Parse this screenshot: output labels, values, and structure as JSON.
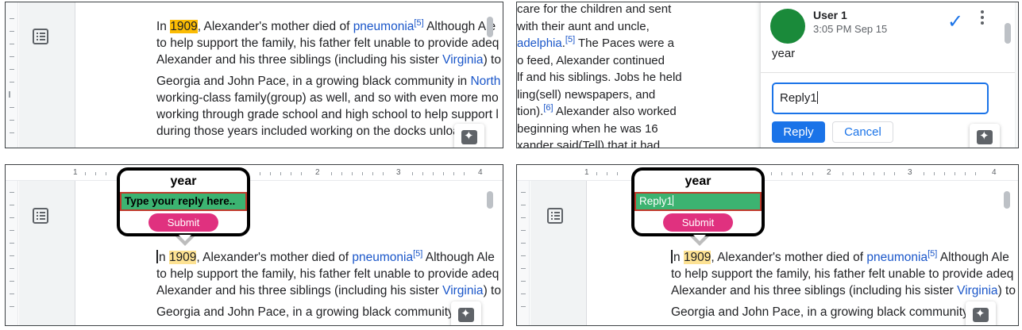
{
  "doc": {
    "year_highlight": "1909",
    "line1_after_year": ", Alexander's mother died of ",
    "line1_link": "pneumonia",
    "line1_ref": "[5]",
    "line1_tail": " Although Ale",
    "line2": "to help support the family, his father felt unable to provide adeq",
    "line3_pre": "Alexander and his three siblings (including his sister ",
    "line3_link": "Virginia",
    "line3_tail": ") to",
    "line4_pre": "Georgia and John Pace, in a growing black community in ",
    "line4_link": "North",
    "line4_short": "Georgia and John Pace, in a growing black community ir",
    "line5": "working-class family(group) as well, and so with even more mo",
    "line6": "working through grade school and high school to help support l",
    "line7": "during those years included working on the docks unloa",
    "word_in": "In ",
    "word_in_short": "n "
  },
  "doc2": {
    "l1": "care for the children and sent",
    "l2": "with their aunt and uncle,",
    "l3_link": "adelphia",
    "l3_ref": "[5]",
    "l3_tail": " The Paces were a",
    "l4": "o feed, Alexander continued",
    "l5": "lf and his siblings. Jobs he held",
    "l6": "ling(sell) newspapers, and",
    "l7_pre": "tion).",
    "l7_ref": "[6]",
    "l7_tail": " Alexander also worked",
    "l8": "beginning when he was 16",
    "l9": "xander said(Tell) that it had"
  },
  "comment": {
    "user": "User 1",
    "time": "3:05 PM Sep 15",
    "text": "year",
    "reply_value": "Reply1",
    "reply_button": "Reply",
    "cancel_button": "Cancel"
  },
  "bubble_left": {
    "title": "year",
    "placeholder": "Type your reply here..",
    "submit": "Submit"
  },
  "bubble_right": {
    "title": "year",
    "value": "Reply1",
    "submit": "Submit"
  },
  "ruler": {
    "n1": "1",
    "n2": "2",
    "n3": "3",
    "n4": "4"
  },
  "colors": {
    "link": "#1a56c9",
    "highlight": "#fbbc04",
    "accent": "#1a73e8",
    "avatar": "#1a8a3a",
    "bubble_input": "#3cb371",
    "submit": "#e0317f"
  }
}
